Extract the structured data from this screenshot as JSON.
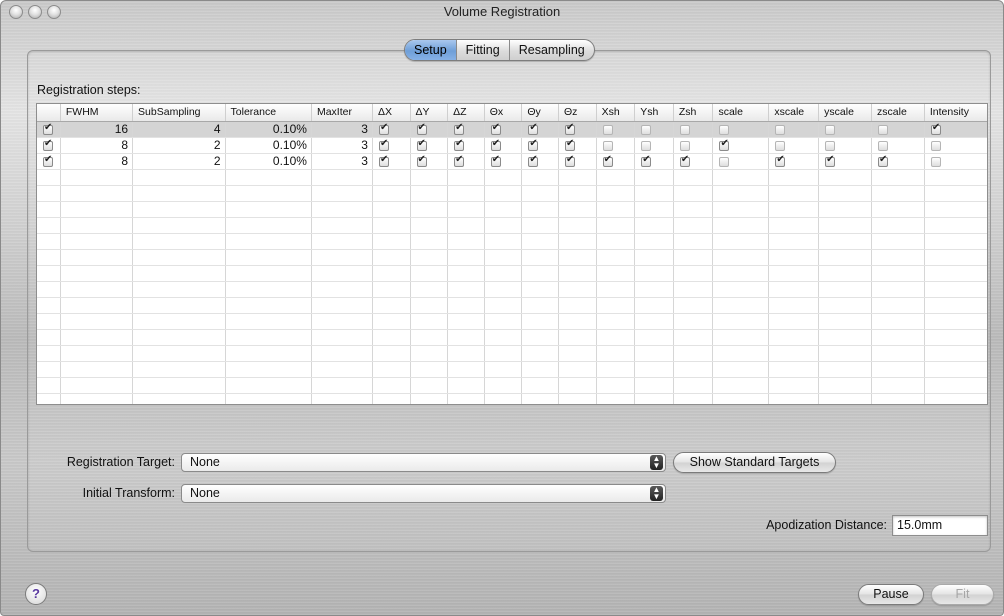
{
  "window": {
    "title": "Volume Registration"
  },
  "tabs": [
    {
      "label": "Setup",
      "active": true
    },
    {
      "label": "Fitting",
      "active": false
    },
    {
      "label": "Resampling",
      "active": false
    }
  ],
  "registration_steps": {
    "label": "Registration steps:",
    "columns": [
      "",
      "FWHM",
      "SubSampling",
      "Tolerance",
      "MaxIter",
      "ΔX",
      "ΔY",
      "ΔZ",
      "Θx",
      "Θy",
      "Θz",
      "Xsh",
      "Ysh",
      "Zsh",
      "scale",
      "xscale",
      "yscale",
      "zscale",
      "Intensity"
    ],
    "rows": [
      {
        "enabled": true,
        "fwhm": "16",
        "subsampling": "4",
        "tolerance": "0.10%",
        "maxiter": "3",
        "flags": [
          true,
          true,
          true,
          true,
          true,
          true,
          false,
          false,
          false,
          false,
          false,
          false,
          false,
          true
        ]
      },
      {
        "enabled": true,
        "fwhm": "8",
        "subsampling": "2",
        "tolerance": "0.10%",
        "maxiter": "3",
        "flags": [
          true,
          true,
          true,
          true,
          true,
          true,
          false,
          false,
          false,
          true,
          false,
          false,
          false,
          false
        ]
      },
      {
        "enabled": true,
        "fwhm": "8",
        "subsampling": "2",
        "tolerance": "0.10%",
        "maxiter": "3",
        "flags": [
          true,
          true,
          true,
          true,
          true,
          true,
          true,
          true,
          true,
          false,
          true,
          true,
          true,
          false
        ]
      }
    ],
    "empty_rows": 15
  },
  "registration_target": {
    "label": "Registration Target:",
    "value": "None"
  },
  "show_standard_targets": "Show Standard Targets",
  "initial_transform": {
    "label": "Initial Transform:",
    "value": "None"
  },
  "apodization": {
    "label": "Apodization Distance:",
    "value": "15.0mm"
  },
  "buttons": {
    "help": "?",
    "pause": "Pause",
    "fit": "Fit"
  }
}
